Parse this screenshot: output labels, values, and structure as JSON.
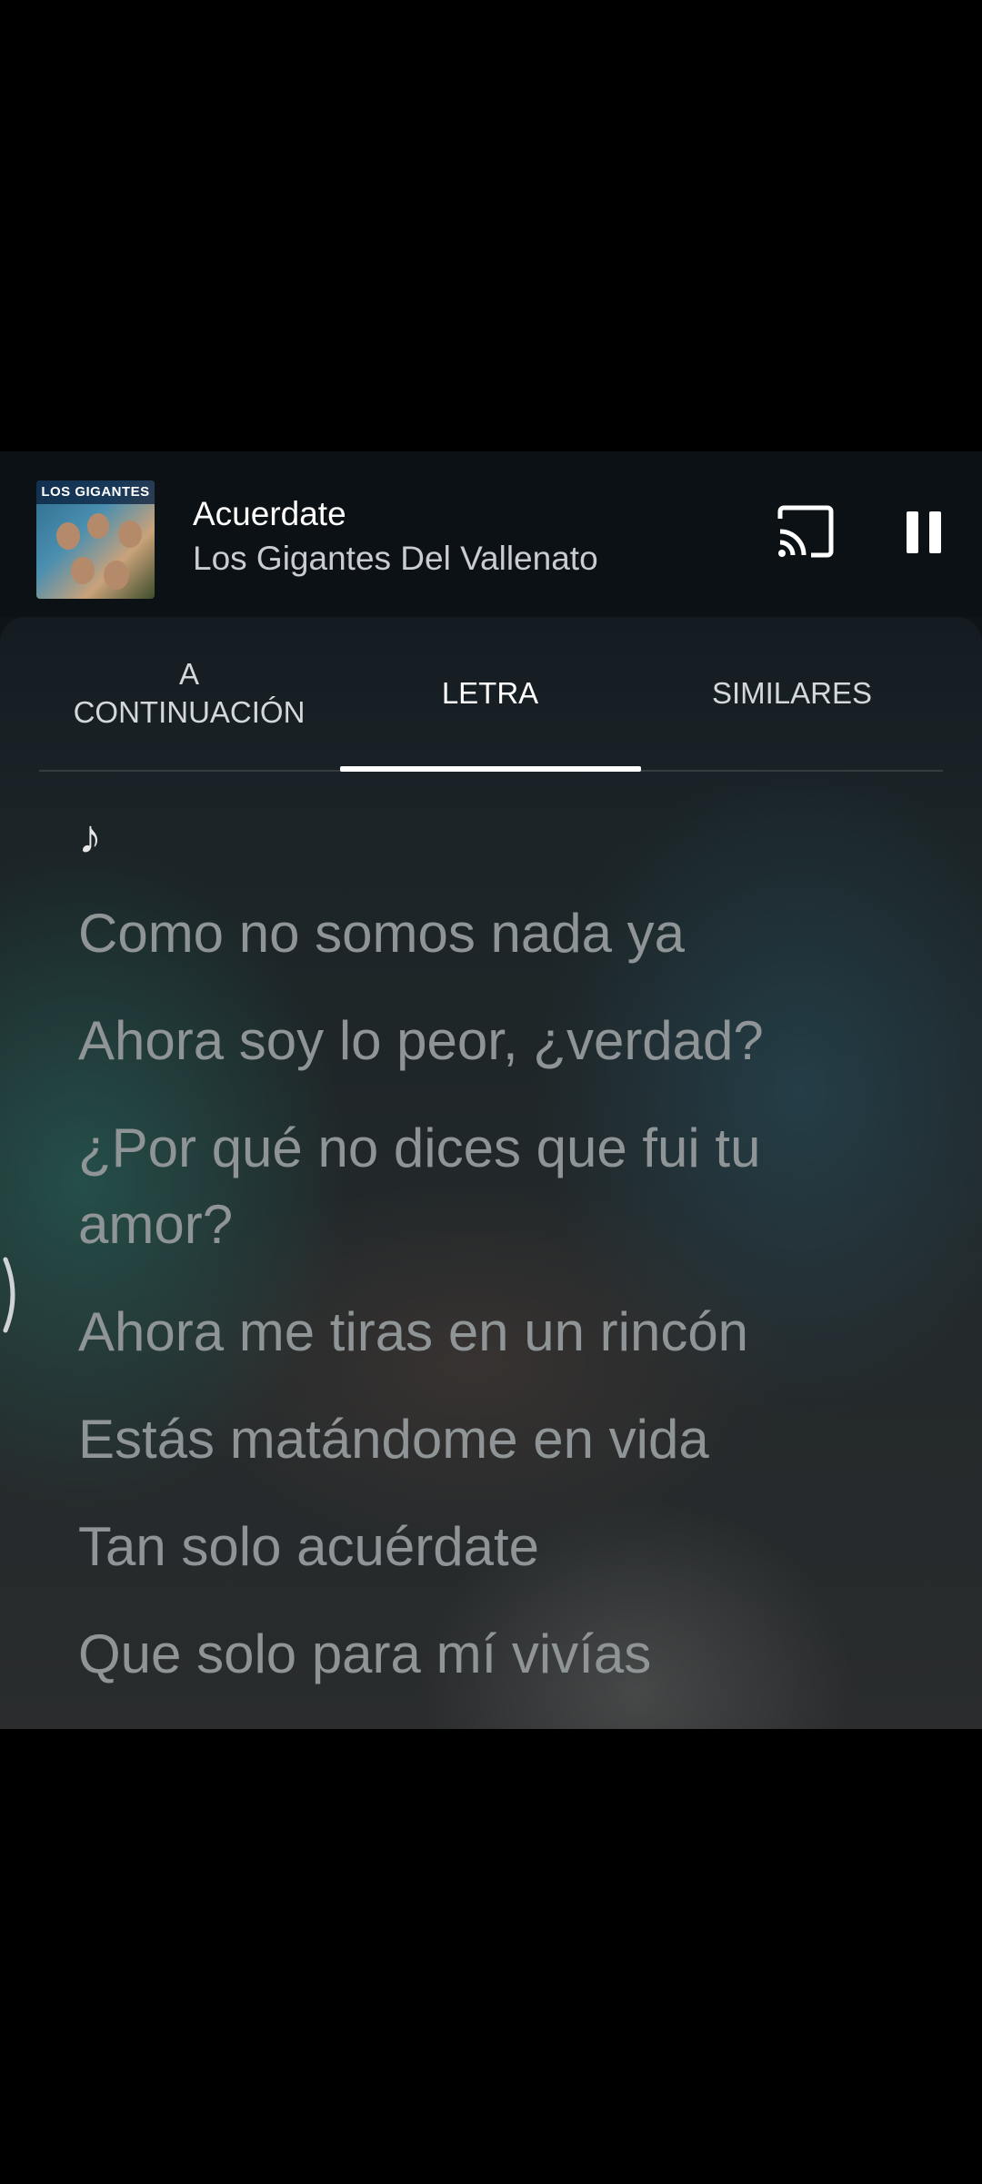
{
  "mini_player": {
    "title": "Acuerdate",
    "artist": "Los Gigantes Del Vallenato",
    "album_art_text": "LOS GIGANTES"
  },
  "tabs": [
    {
      "label": "A\nCONTINUACIÓN",
      "active": false
    },
    {
      "label": "LETRA",
      "active": true
    },
    {
      "label": "SIMILARES",
      "active": false
    }
  ],
  "lyrics": {
    "note": "♪",
    "lines": [
      "Como no somos nada ya",
      "Ahora soy lo peor, ¿verdad?",
      "¿Por qué no dices que fui tu amor?",
      "Ahora me tiras en un rincón",
      "Estás matándome en vida",
      "Tan solo acuérdate",
      "Que solo para mí vivías"
    ]
  },
  "icons": {
    "cast": "cast-icon",
    "pause": "pause-icon"
  }
}
